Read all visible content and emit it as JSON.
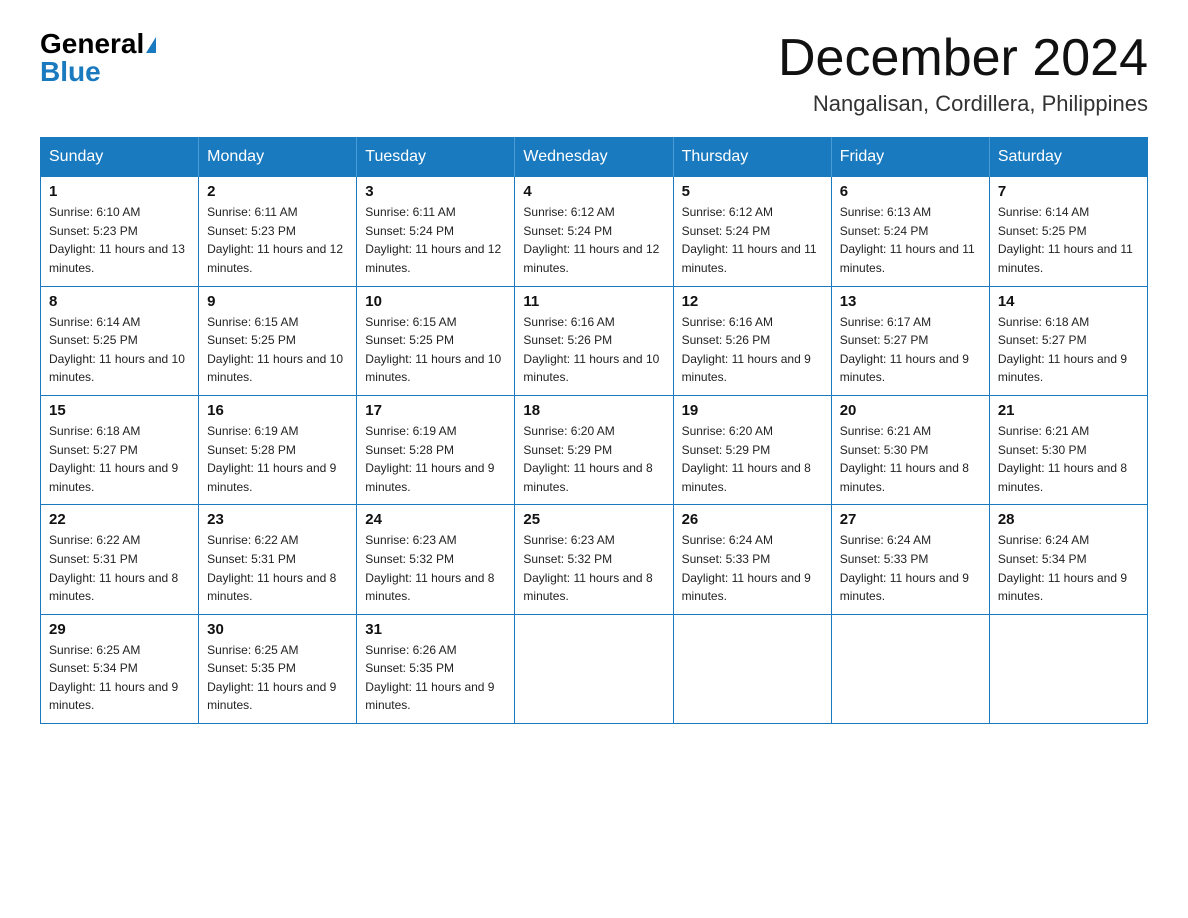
{
  "header": {
    "logo_general": "General",
    "logo_blue": "Blue",
    "month_title": "December 2024",
    "location": "Nangalisan, Cordillera, Philippines"
  },
  "weekdays": [
    "Sunday",
    "Monday",
    "Tuesday",
    "Wednesday",
    "Thursday",
    "Friday",
    "Saturday"
  ],
  "weeks": [
    [
      {
        "day": "1",
        "sunrise": "6:10 AM",
        "sunset": "5:23 PM",
        "daylight": "11 hours and 13 minutes."
      },
      {
        "day": "2",
        "sunrise": "6:11 AM",
        "sunset": "5:23 PM",
        "daylight": "11 hours and 12 minutes."
      },
      {
        "day": "3",
        "sunrise": "6:11 AM",
        "sunset": "5:24 PM",
        "daylight": "11 hours and 12 minutes."
      },
      {
        "day": "4",
        "sunrise": "6:12 AM",
        "sunset": "5:24 PM",
        "daylight": "11 hours and 12 minutes."
      },
      {
        "day": "5",
        "sunrise": "6:12 AM",
        "sunset": "5:24 PM",
        "daylight": "11 hours and 11 minutes."
      },
      {
        "day": "6",
        "sunrise": "6:13 AM",
        "sunset": "5:24 PM",
        "daylight": "11 hours and 11 minutes."
      },
      {
        "day": "7",
        "sunrise": "6:14 AM",
        "sunset": "5:25 PM",
        "daylight": "11 hours and 11 minutes."
      }
    ],
    [
      {
        "day": "8",
        "sunrise": "6:14 AM",
        "sunset": "5:25 PM",
        "daylight": "11 hours and 10 minutes."
      },
      {
        "day": "9",
        "sunrise": "6:15 AM",
        "sunset": "5:25 PM",
        "daylight": "11 hours and 10 minutes."
      },
      {
        "day": "10",
        "sunrise": "6:15 AM",
        "sunset": "5:25 PM",
        "daylight": "11 hours and 10 minutes."
      },
      {
        "day": "11",
        "sunrise": "6:16 AM",
        "sunset": "5:26 PM",
        "daylight": "11 hours and 10 minutes."
      },
      {
        "day": "12",
        "sunrise": "6:16 AM",
        "sunset": "5:26 PM",
        "daylight": "11 hours and 9 minutes."
      },
      {
        "day": "13",
        "sunrise": "6:17 AM",
        "sunset": "5:27 PM",
        "daylight": "11 hours and 9 minutes."
      },
      {
        "day": "14",
        "sunrise": "6:18 AM",
        "sunset": "5:27 PM",
        "daylight": "11 hours and 9 minutes."
      }
    ],
    [
      {
        "day": "15",
        "sunrise": "6:18 AM",
        "sunset": "5:27 PM",
        "daylight": "11 hours and 9 minutes."
      },
      {
        "day": "16",
        "sunrise": "6:19 AM",
        "sunset": "5:28 PM",
        "daylight": "11 hours and 9 minutes."
      },
      {
        "day": "17",
        "sunrise": "6:19 AM",
        "sunset": "5:28 PM",
        "daylight": "11 hours and 9 minutes."
      },
      {
        "day": "18",
        "sunrise": "6:20 AM",
        "sunset": "5:29 PM",
        "daylight": "11 hours and 8 minutes."
      },
      {
        "day": "19",
        "sunrise": "6:20 AM",
        "sunset": "5:29 PM",
        "daylight": "11 hours and 8 minutes."
      },
      {
        "day": "20",
        "sunrise": "6:21 AM",
        "sunset": "5:30 PM",
        "daylight": "11 hours and 8 minutes."
      },
      {
        "day": "21",
        "sunrise": "6:21 AM",
        "sunset": "5:30 PM",
        "daylight": "11 hours and 8 minutes."
      }
    ],
    [
      {
        "day": "22",
        "sunrise": "6:22 AM",
        "sunset": "5:31 PM",
        "daylight": "11 hours and 8 minutes."
      },
      {
        "day": "23",
        "sunrise": "6:22 AM",
        "sunset": "5:31 PM",
        "daylight": "11 hours and 8 minutes."
      },
      {
        "day": "24",
        "sunrise": "6:23 AM",
        "sunset": "5:32 PM",
        "daylight": "11 hours and 8 minutes."
      },
      {
        "day": "25",
        "sunrise": "6:23 AM",
        "sunset": "5:32 PM",
        "daylight": "11 hours and 8 minutes."
      },
      {
        "day": "26",
        "sunrise": "6:24 AM",
        "sunset": "5:33 PM",
        "daylight": "11 hours and 9 minutes."
      },
      {
        "day": "27",
        "sunrise": "6:24 AM",
        "sunset": "5:33 PM",
        "daylight": "11 hours and 9 minutes."
      },
      {
        "day": "28",
        "sunrise": "6:24 AM",
        "sunset": "5:34 PM",
        "daylight": "11 hours and 9 minutes."
      }
    ],
    [
      {
        "day": "29",
        "sunrise": "6:25 AM",
        "sunset": "5:34 PM",
        "daylight": "11 hours and 9 minutes."
      },
      {
        "day": "30",
        "sunrise": "6:25 AM",
        "sunset": "5:35 PM",
        "daylight": "11 hours and 9 minutes."
      },
      {
        "day": "31",
        "sunrise": "6:26 AM",
        "sunset": "5:35 PM",
        "daylight": "11 hours and 9 minutes."
      },
      null,
      null,
      null,
      null
    ]
  ]
}
